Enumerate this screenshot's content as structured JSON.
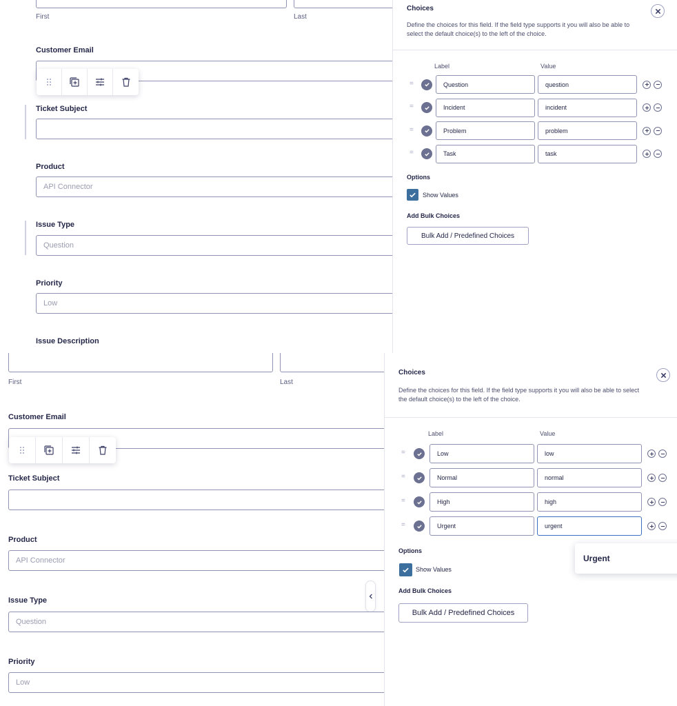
{
  "panel_top": {
    "form": {
      "name_first_label": "First",
      "name_last_label": "Last",
      "customer_email_label": "Customer Email",
      "ticket_subject_label": "Ticket Subject",
      "product_label": "Product",
      "product_value": "API Connector",
      "issue_type_label": "Issue Type",
      "issue_type_value": "Question",
      "priority_label": "Priority",
      "priority_value": "Low",
      "issue_description_label": "Issue Description"
    },
    "choices": {
      "title": "Choices",
      "description": "Define the choices for this field. If the field type supports it you will also be able to select the default choice(s) to the left of the choice.",
      "label_header": "Label",
      "value_header": "Value",
      "rows": [
        {
          "label": "Question",
          "value": "question"
        },
        {
          "label": "Incident",
          "value": "incident"
        },
        {
          "label": "Problem",
          "value": "problem"
        },
        {
          "label": "Task",
          "value": "task"
        }
      ],
      "options_label": "Options",
      "show_values_label": "Show Values",
      "add_bulk_label": "Add Bulk Choices",
      "bulk_button_label": "Bulk Add / Predefined Choices"
    }
  },
  "panel_bottom": {
    "form": {
      "name_first_label": "First",
      "name_last_label": "Last",
      "customer_email_label": "Customer Email",
      "ticket_subject_label": "Ticket Subject",
      "product_label": "Product",
      "product_value": "API Connector",
      "issue_type_label": "Issue Type",
      "issue_type_value": "Question",
      "priority_label": "Priority",
      "priority_value": "Low"
    },
    "choices": {
      "title": "Choices",
      "description": "Define the choices for this field. If the field type supports it you will also be able to select the default choice(s) to the left of the choice.",
      "label_header": "Label",
      "value_header": "Value",
      "rows": [
        {
          "label": "Low",
          "value": "low"
        },
        {
          "label": "Normal",
          "value": "normal"
        },
        {
          "label": "High",
          "value": "high"
        },
        {
          "label": "Urgent",
          "value": "urgent"
        }
      ],
      "options_label": "Options",
      "show_values_label": "Show Values",
      "add_bulk_label": "Add Bulk Choices",
      "bulk_button_label": "Bulk Add / Predefined Choices",
      "tooltip_text": "Urgent"
    }
  },
  "icons": {
    "drag": "drag-handle-icon",
    "duplicate": "duplicate-icon",
    "settings": "sliders-icon",
    "delete": "trash-icon",
    "close": "close-icon",
    "check": "check-icon",
    "add": "plus-icon",
    "remove": "minus-icon",
    "collapse": "chevron-left-icon"
  },
  "colors": {
    "accent": "#3d6f9e",
    "active_border": "#3b6fc4",
    "text": "#242748",
    "border": "#9092b2"
  }
}
